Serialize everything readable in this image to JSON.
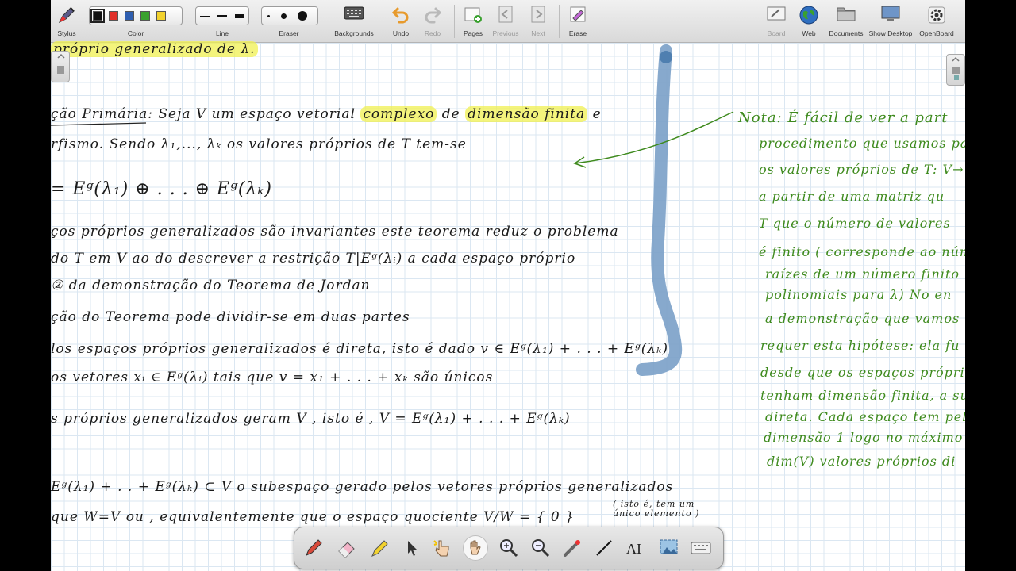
{
  "toolbar": {
    "stylus": "Stylus",
    "color": "Color",
    "line": "Line",
    "eraser": "Eraser",
    "backgrounds": "Backgrounds",
    "undo": "Undo",
    "redo": "Redo",
    "pages": "Pages",
    "previous": "Previous",
    "next": "Next",
    "erase": "Erase",
    "board": "Board",
    "web": "Web",
    "documents": "Documents",
    "show_desktop": "Show Desktop",
    "openboard": "OpenBoard",
    "swatches": [
      "#111111",
      "#e0302a",
      "#2f5fb0",
      "#3aa12f",
      "#f2d22e"
    ],
    "selected_color": "#111111"
  },
  "notes": {
    "line1": "próprio generalizado de λ.",
    "line2a": "ção Primária",
    "line2b": ": Seja  V  um  espaço vetorial",
    "line2_hl1": "complexo",
    "line2c": "de",
    "line2_hl2": "dimensão finita",
    "line2d": " e",
    "line3": "rfismo.  Sendo  λ₁,..., λₖ  os  valores  próprios  de  T   tem-se",
    "line4": "= Eᵍ(λ₁) ⊕  . . .  ⊕ Eᵍ(λₖ)",
    "line5": "ços próprios generalizados são invariantes  este teorema  reduz  o   problema",
    "line6": "  do  T em V  ao do  descrever  a restrição   T|Eᵍ(λᵢ)   a  cada  espaço  próprio",
    "line7": "②   da demonstração  do  Teorema de Jordan",
    "line8": "ção  do  Teorema  pode  dividir-se  em  duas   partes",
    "line9": "los espaços próprios generalizados é direta, isto é dado  v ∈ Eᵍ(λ₁) +  . . . + Eᵍ(λₖ)",
    "line10": "  os vetores   xᵢ ∈ Eᵍ(λᵢ)   tais que     v = x₁ + . . . + xₖ   são únicos",
    "line11": "s  próprios  generalizados  geram  V ,  isto é ,   V = Eᵍ(λ₁) + . . . + Eᵍ(λₖ)",
    "line12": "Eᵍ(λ₁) + . . + Eᵍ(λₖ)  ⊂ V    o  subespaço  gerado  pelos  vetores  próprios  generalizados",
    "line13": "que   W=V  ou ,  equivalentemente      que  o  espaço  quociente   V/W  =  { 0 }",
    "line13_note": "( isto é, tem um único elemento )"
  },
  "side_note": {
    "lines": [
      "Nota:  É  fácil  de  ver  a  part",
      "procedimento  que  usamos  para",
      "os  valores  próprios  de  T: V→",
      "a  partir  de  uma  matriz  qu",
      "T  que  o  número  de  valores",
      "é  finito  ( corresponde  ao  núm",
      "raízes  de  um  número  finito",
      "polinomiais  para  λ)    No  en",
      "a  demonstração  que  vamos",
      "requer  esta  hipótese:  ela  fu",
      "desde  que  os  espaços  próprios  ge",
      "tenham  dimensão  finita,  a  sua",
      "direta.   Cada  espaço  tem  pel",
      "dimensão 1  logo  no  máximo",
      "dim(V)  valores  próprios  di"
    ]
  },
  "floating_tools": [
    "pen",
    "eraser",
    "marker",
    "selector",
    "interactor",
    "hand",
    "zoom-in",
    "zoom-out",
    "laser-pointer",
    "line",
    "text",
    "capture",
    "virtual-keyboard"
  ],
  "floating_active": "hand"
}
